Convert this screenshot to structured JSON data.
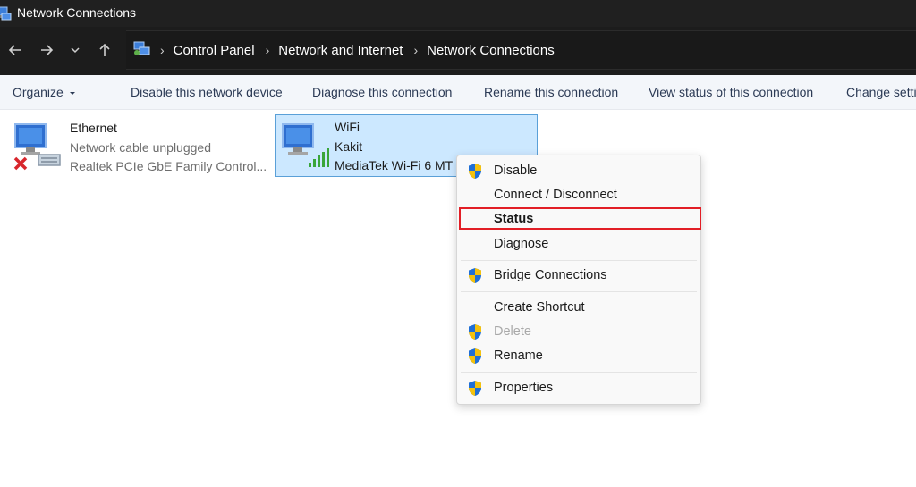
{
  "window": {
    "title": "Network Connections"
  },
  "address_bar": {
    "crumbs": [
      "Control Panel",
      "Network and Internet",
      "Network Connections"
    ]
  },
  "toolbar": {
    "organize": "Organize",
    "items": [
      "Disable this network device",
      "Diagnose this connection",
      "Rename this connection",
      "View status of this connection",
      "Change setti"
    ]
  },
  "adapters": [
    {
      "name": "Ethernet",
      "status": "Network cable unplugged",
      "device": "Realtek PCIe GbE Family Control...",
      "selected": false
    },
    {
      "name": "WiFi",
      "status": "Kakit",
      "device": "MediaTek Wi-Fi 6 MT",
      "selected": true
    }
  ],
  "context_menu": {
    "items": [
      {
        "label": "Disable",
        "shield": true,
        "enabled": true
      },
      {
        "label": "Connect / Disconnect",
        "shield": false,
        "enabled": true
      },
      {
        "label": "Status",
        "shield": false,
        "enabled": true,
        "bold": true,
        "highlighted": true
      },
      {
        "label": "Diagnose",
        "shield": false,
        "enabled": true
      },
      {
        "label": "Bridge Connections",
        "shield": true,
        "enabled": true
      },
      {
        "label": "Create Shortcut",
        "shield": false,
        "enabled": true
      },
      {
        "label": "Delete",
        "shield": true,
        "enabled": false
      },
      {
        "label": "Rename",
        "shield": true,
        "enabled": true
      },
      {
        "label": "Properties",
        "shield": true,
        "enabled": true
      }
    ]
  },
  "colors": {
    "selection": "#cce8ff",
    "highlight_box": "#e21e26",
    "titlebar": "#202020"
  }
}
